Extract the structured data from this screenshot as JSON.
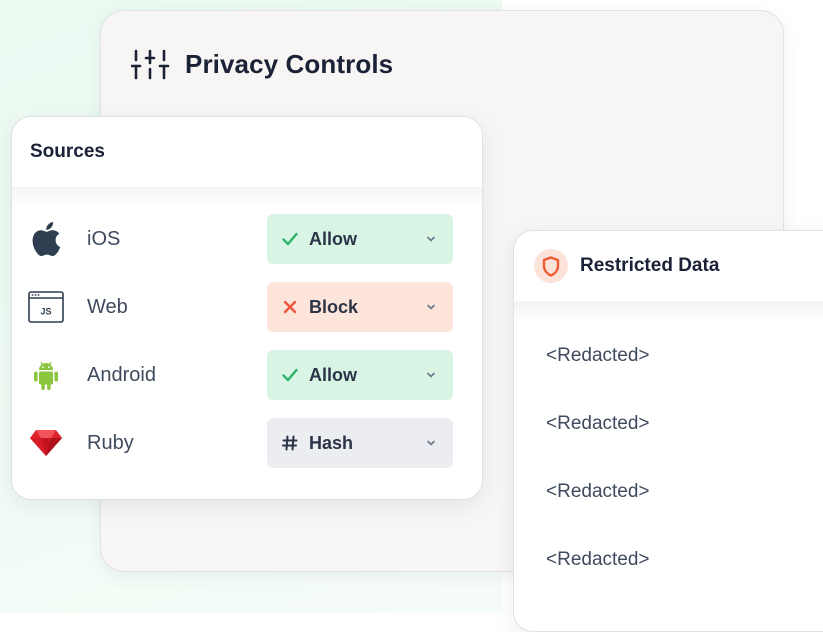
{
  "privacy": {
    "title": "Privacy Controls",
    "icon": "sliders-icon"
  },
  "sources": {
    "title": "Sources",
    "items": [
      {
        "label": "iOS",
        "icon": "apple-icon",
        "policy": "Allow",
        "policy_icon": "check-icon",
        "policy_color": "#d7f4e4"
      },
      {
        "label": "Web",
        "icon": "javascript-window-icon",
        "policy": "Block",
        "policy_icon": "x-icon",
        "policy_color": "#fde5dc"
      },
      {
        "label": "Android",
        "icon": "android-icon",
        "policy": "Allow",
        "policy_icon": "check-icon",
        "policy_color": "#d7f4e4"
      },
      {
        "label": "Ruby",
        "icon": "ruby-gem-icon",
        "policy": "Hash",
        "policy_icon": "hash-icon",
        "policy_color": "#ecedf1"
      }
    ],
    "web_icon_text": "JS"
  },
  "restricted": {
    "title": "Restricted Data",
    "icon": "shield-icon",
    "items": [
      "<Redacted>",
      "<Redacted>",
      "<Redacted>",
      "<Redacted>"
    ]
  },
  "colors": {
    "allow_green": "#2fb36b",
    "block_red": "#f0533a",
    "shield_orange": "#ef5b2f",
    "title_navy": "#1b2238"
  }
}
